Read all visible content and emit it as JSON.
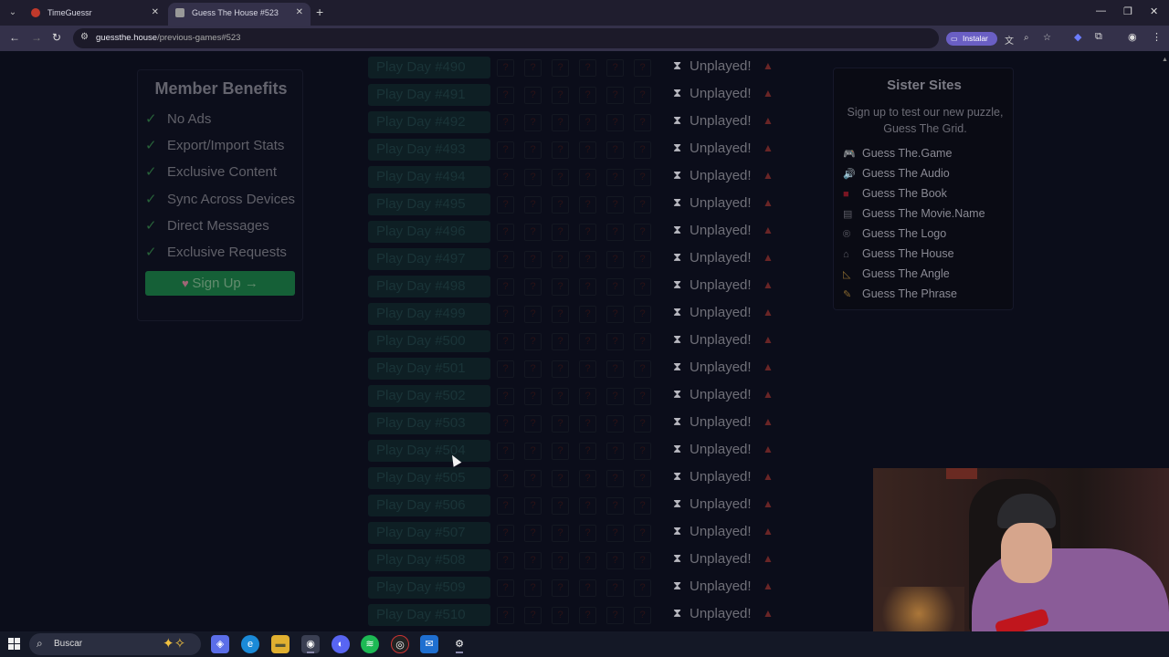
{
  "browser": {
    "tabs": [
      {
        "title": "TimeGuessr",
        "active": false
      },
      {
        "title": "Guess The House #523",
        "active": true
      }
    ],
    "url_host": "guessthe.house",
    "url_path": "/previous-games#523",
    "install_label": "Instalar",
    "icons": {
      "back": "back-arrow-icon",
      "forward": "forward-arrow-icon",
      "reload": "reload-icon",
      "site_info": "tune-icon",
      "translate": "translate-icon",
      "zoom": "zoom-icon",
      "bookmark": "star-icon",
      "extensions": "puzzle-icon",
      "menu": "kebab-menu-icon"
    }
  },
  "member_benefits": {
    "title": "Member Benefits",
    "items": [
      "No Ads",
      "Export/Import Stats",
      "Exclusive Content",
      "Sync Across Devices",
      "Direct Messages",
      "Exclusive Requests"
    ],
    "signup_label": "Sign Up →"
  },
  "games": {
    "rows": [
      {
        "label": "Play Day #490",
        "status": "Unplayed!"
      },
      {
        "label": "Play Day #491",
        "status": "Unplayed!"
      },
      {
        "label": "Play Day #492",
        "status": "Unplayed!"
      },
      {
        "label": "Play Day #493",
        "status": "Unplayed!"
      },
      {
        "label": "Play Day #494",
        "status": "Unplayed!"
      },
      {
        "label": "Play Day #495",
        "status": "Unplayed!"
      },
      {
        "label": "Play Day #496",
        "status": "Unplayed!"
      },
      {
        "label": "Play Day #497",
        "status": "Unplayed!"
      },
      {
        "label": "Play Day #498",
        "status": "Unplayed!"
      },
      {
        "label": "Play Day #499",
        "status": "Unplayed!"
      },
      {
        "label": "Play Day #500",
        "status": "Unplayed!"
      },
      {
        "label": "Play Day #501",
        "status": "Unplayed!"
      },
      {
        "label": "Play Day #502",
        "status": "Unplayed!"
      },
      {
        "label": "Play Day #503",
        "status": "Unplayed!"
      },
      {
        "label": "Play Day #504",
        "status": "Unplayed!"
      },
      {
        "label": "Play Day #505",
        "status": "Unplayed!"
      },
      {
        "label": "Play Day #506",
        "status": "Unplayed!"
      },
      {
        "label": "Play Day #507",
        "status": "Unplayed!"
      },
      {
        "label": "Play Day #508",
        "status": "Unplayed!"
      },
      {
        "label": "Play Day #509",
        "status": "Unplayed!"
      },
      {
        "label": "Play Day #510",
        "status": "Unplayed!"
      }
    ],
    "box_glyph": "?"
  },
  "sister_sites": {
    "title": "Sister Sites",
    "description": "Sign up to test our new puzzle, Guess The Grid.",
    "sites": [
      {
        "label": "Guess The.Game",
        "icon": "gamepad-icon"
      },
      {
        "label": "Guess The Audio",
        "icon": "speaker-icon"
      },
      {
        "label": "Guess The Book",
        "icon": "book-icon"
      },
      {
        "label": "Guess The Movie.Name",
        "icon": "clapperboard-icon"
      },
      {
        "label": "Guess The Logo",
        "icon": "registered-icon"
      },
      {
        "label": "Guess The House",
        "icon": "house-icon"
      },
      {
        "label": "Guess The Angle",
        "icon": "ruler-angle-icon"
      },
      {
        "label": "Guess The Phrase",
        "icon": "quill-icon"
      }
    ]
  },
  "taskbar": {
    "search_placeholder": "Buscar",
    "apps": [
      "copilot-icon",
      "edge-icon",
      "file-explorer-icon",
      "chrome-icon",
      "discord-icon",
      "spotify-icon",
      "app-icon",
      "mail-icon",
      "steam-icon"
    ]
  },
  "colors": {
    "page_bg": "#0b0d1a",
    "signup_green": "#17693b",
    "check_green": "#2b6b3d",
    "warn_red": "#6a2526"
  }
}
